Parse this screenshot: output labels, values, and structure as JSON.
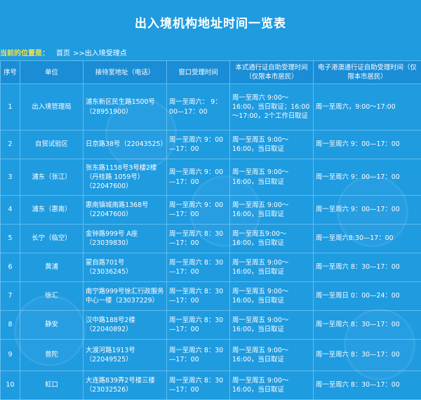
{
  "page": {
    "title": "出入境机构地址时间一览表",
    "breadcrumb_lead": "当前的位置是：",
    "breadcrumb_home": "首页",
    "breadcrumb_current": ">>出入境受理点"
  },
  "table": {
    "headers": [
      "序号",
      "单位",
      "接待室地址（电话）",
      "窗口受理时间",
      "本式通行证自助受理时间（仅限本市居民）",
      "电子港澳通行证自助受理时间（仅限本市居民）"
    ],
    "rows": [
      [
        "1",
        "出入境管理局",
        "浦东新区民生路1500号（28951900）",
        "周一至周六： 9：00—17：00",
        "周一至周六 9:00～16:00，当日取证；16:00～17:00，2个工作日取证",
        "周一至周六，9:00～17:00"
      ],
      [
        "2",
        "自贸试验区",
        "日京路38号（22043525）",
        "周一至周六 9：00—17：00",
        "周一至周五 9:00～16:00，当日取证",
        "周一至周六 9：00—17：00"
      ],
      [
        "3",
        "浦东（张江）",
        "张东路1158号3号楼2楼（丹桂路 1059号）（22047600）",
        "周一至周六 9：00—17：00",
        "周一至周五 9:00～16:00，当日取证",
        "周一至周六 9：00—17：00"
      ],
      [
        "4",
        "浦东（惠南）",
        "惠南镇城南路1368号（22047600）",
        "周一至周六 9：00—17：00",
        "周一至周五 9:00～16:00，当日取证",
        "周一至周六 9：00—17：00"
      ],
      [
        "5",
        "长宁（临空）",
        "金钟路999号 A座（23039830）",
        "周一至周六 8：30—17：00",
        "周一至周五9:00～16:00，当日取证",
        "周一至周六8:30—17：00"
      ],
      [
        "6",
        "黄浦",
        "蒙自路701号（23036245）",
        "周一至周六 8：30—17：00",
        "周一至周五 9:00～16:00，当日取证",
        "周一至周六 8：30—17：00"
      ],
      [
        "7",
        "徐汇",
        "南宁路999号徐汇行政服务中心一楼（23037229）",
        "周一至周六 8：30—17：00",
        "周一至周五 9:00～16:00，当日取证",
        "周一至周日 0：00—24：00"
      ],
      [
        "8",
        "静安",
        "汉中路188号2楼（22040892）",
        "周一至周六 8：30—17：00",
        "周一至周五 9:00～16:00，当日取证",
        "周一至周六 8：30—17：00"
      ],
      [
        "9",
        "普陀",
        "大渡河路1913号（22049525）",
        "周一至周六 8：30—17：00",
        "周一至周五 9:00～16:00，当日取证",
        "周一至周六 8：30—17：00"
      ],
      [
        "10",
        "虹口",
        "大连路839弄2号楼三楼（23032526）",
        "周一至周六 8：30—17：00",
        "周一至周五 9:00～16:00，当日取证",
        "周一至周六 8：30—17：00"
      ]
    ]
  }
}
